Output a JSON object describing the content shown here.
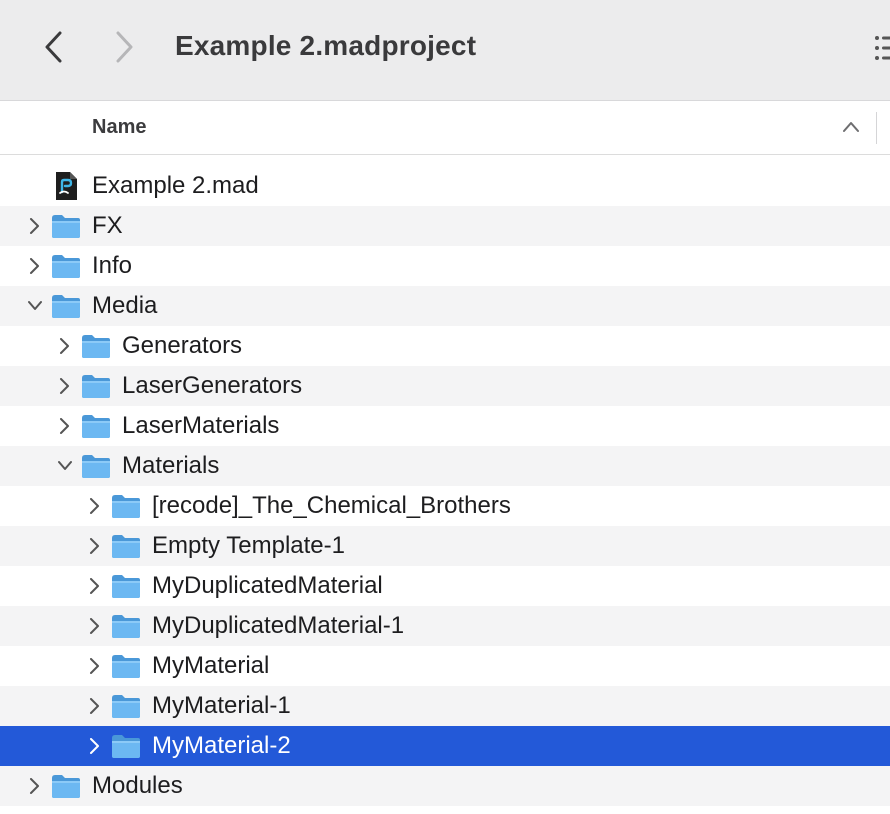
{
  "toolbar": {
    "title": "Example 2.madproject",
    "back_icon": "chevron-left-icon",
    "forward_icon": "chevron-right-icon",
    "view_options_icon": "list-view-icon"
  },
  "header": {
    "name_column": "Name",
    "sort_icon": "chevron-up-icon"
  },
  "colors": {
    "selection": "#2359d8",
    "folder": "#6cb8f2",
    "stripe": "#f4f4f5"
  },
  "rows": [
    {
      "label": "Example 2.mad",
      "depth": 0,
      "kind": "file",
      "disclosure": "none"
    },
    {
      "label": "FX",
      "depth": 0,
      "kind": "folder",
      "disclosure": "collapsed"
    },
    {
      "label": "Info",
      "depth": 0,
      "kind": "folder",
      "disclosure": "collapsed"
    },
    {
      "label": "Media",
      "depth": 0,
      "kind": "folder",
      "disclosure": "expanded"
    },
    {
      "label": "Generators",
      "depth": 1,
      "kind": "folder",
      "disclosure": "collapsed"
    },
    {
      "label": "LaserGenerators",
      "depth": 1,
      "kind": "folder",
      "disclosure": "collapsed"
    },
    {
      "label": "LaserMaterials",
      "depth": 1,
      "kind": "folder",
      "disclosure": "collapsed"
    },
    {
      "label": "Materials",
      "depth": 1,
      "kind": "folder",
      "disclosure": "expanded"
    },
    {
      "label": "[recode]_The_Chemical_Brothers",
      "depth": 2,
      "kind": "folder",
      "disclosure": "collapsed"
    },
    {
      "label": "Empty Template-1",
      "depth": 2,
      "kind": "folder",
      "disclosure": "collapsed"
    },
    {
      "label": "MyDuplicatedMaterial",
      "depth": 2,
      "kind": "folder",
      "disclosure": "collapsed"
    },
    {
      "label": "MyDuplicatedMaterial-1",
      "depth": 2,
      "kind": "folder",
      "disclosure": "collapsed"
    },
    {
      "label": "MyMaterial",
      "depth": 2,
      "kind": "folder",
      "disclosure": "collapsed"
    },
    {
      "label": "MyMaterial-1",
      "depth": 2,
      "kind": "folder",
      "disclosure": "collapsed"
    },
    {
      "label": "MyMaterial-2",
      "depth": 2,
      "kind": "folder",
      "disclosure": "collapsed",
      "selected": true
    },
    {
      "label": "Modules",
      "depth": 0,
      "kind": "folder",
      "disclosure": "collapsed"
    }
  ]
}
